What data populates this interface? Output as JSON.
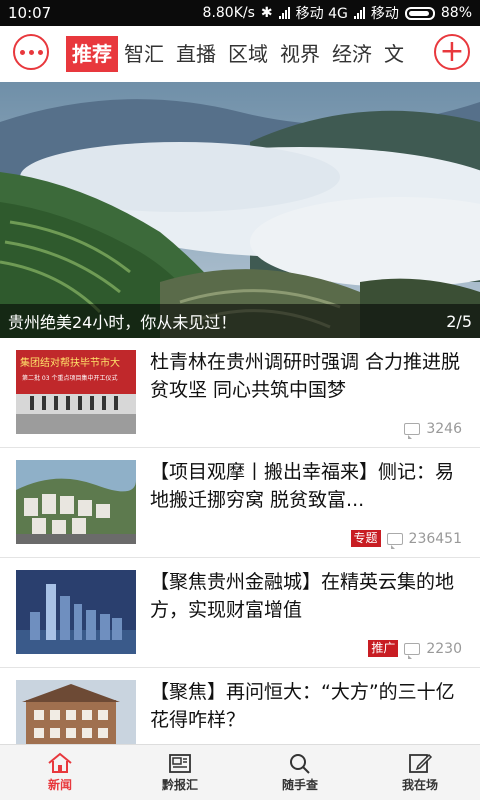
{
  "status_bar": {
    "time": "10:07",
    "speed": "8.80K/s",
    "carrier1": "移动 4G",
    "carrier2": "移动",
    "battery": "88%"
  },
  "nav": {
    "tabs": [
      {
        "label": "推荐",
        "active": true
      },
      {
        "label": "智汇",
        "active": false
      },
      {
        "label": "直播",
        "active": false
      },
      {
        "label": "区域",
        "active": false
      },
      {
        "label": "视界",
        "active": false
      },
      {
        "label": "经济",
        "active": false
      },
      {
        "label": "文",
        "active": false
      }
    ],
    "add_symbol": "+"
  },
  "banner": {
    "caption": "贵州绝美24小时，你从未见过！",
    "pager": "2/5"
  },
  "news": [
    {
      "title": "杜青林在贵州调研时强调 合力推进脱贫攻坚 同心共筑中国梦",
      "badge": "",
      "comments": "3246",
      "thumb_text": "集团结对帮扶毕节市大",
      "thumb_text2": "第二批 03 个重点项目集中开工仪式"
    },
    {
      "title": "【项目观摩丨搬出幸福来】侧记：易地搬迁挪穷窝 脱贫致富...",
      "badge": "专题",
      "comments": "236451"
    },
    {
      "title": "【聚焦贵州金融城】在精英云集的地方，实现财富增值",
      "badge": "推广",
      "comments": "2230"
    },
    {
      "title": "【聚焦】再问恒大：“大方”的三十亿花得咋样？",
      "badge": "",
      "comments": ""
    }
  ],
  "bottom_nav": [
    {
      "label": "新闻",
      "icon": "home-icon",
      "active": true
    },
    {
      "label": "黔报汇",
      "icon": "newspaper-icon",
      "active": false
    },
    {
      "label": "随手查",
      "icon": "search-icon",
      "active": false
    },
    {
      "label": "我在场",
      "icon": "edit-icon",
      "active": false
    }
  ],
  "colors": {
    "accent": "#e8383d",
    "badge": "#c81d23"
  }
}
